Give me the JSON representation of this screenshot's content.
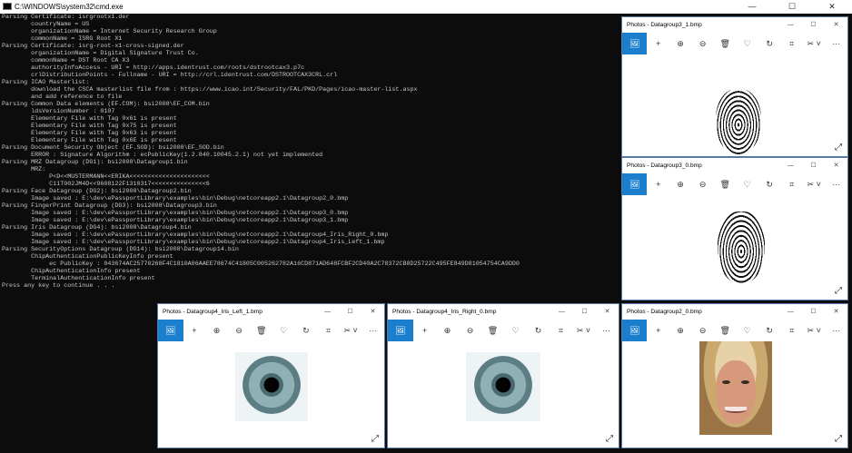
{
  "cmd": {
    "title": "C:\\WINDOWS\\system32\\cmd.exe",
    "controls": [
      "—",
      "☐",
      "✕"
    ],
    "lines": [
      "Parsing Certificate: isrgrootx1.der",
      "        countryName = US",
      "        organizationName = Internet Security Research Group",
      "        commonName = ISRG Root X1",
      "Parsing Certificate: isrg-root-x1-cross-signed.der",
      "        organizationName = Digital Signature Trust Co.",
      "        commonName = DST Root CA X3",
      "        authorityInfoAccess - URI = http://apps.identrust.com/roots/dstrootcax3.p7c",
      "        crlDistributionPoints - Fullname - URI = http://crl.identrust.com/DSTROOTCAX3CRL.crl",
      "Parsing ICAO Masterlist:",
      "        download the CSCA masterlist file from : https://www.icao.int/Security/FAL/PKD/Pages/icao-master-list.aspx",
      "        and add reference to file",
      "Parsing Common Data elements (EF.COM): bsi2008\\EF_COM.bin",
      "        ldsVersionNumber : 0107",
      "        Elementary File with Tag 0x61 is present",
      "        Elementary File with Tag 0x75 is present",
      "        Elementary File with Tag 0x63 is present",
      "        Elementary File with Tag 0x6E is present",
      "Parsing Document Security Object (EF.SOD): bsi2008\\EF_SOD.bin",
      "        ERROR : Signature Algorithm : ecPublicKey(1.2.840.10045.2.1) not yet implemented",
      "Parsing MRZ Datagroup (DG1): bsi2008\\Datagroup1.bin",
      "        MRZ:",
      "             P<D<<MUSTERMANN<<ERIKA<<<<<<<<<<<<<<<<<<<<<<",
      "             C11T002JM4D<<9608122F1310317<<<<<<<<<<<<<<<6",
      "Parsing Face Datagroup (DG2): bsi2008\\Datagroup2.bin",
      "        Image saved : E:\\dev\\ePassportLibrary\\examples\\bin\\Debug\\netcoreapp2.1\\Datagroup2_0.bmp",
      "Parsing FingerPrint Datagroup (DG3): bsi2008\\Datagroup3.bin",
      "        Image saved : E:\\dev\\ePassportLibrary\\examples\\bin\\Debug\\netcoreapp2.1\\Datagroup3_0.bmp",
      "        Image saved : E:\\dev\\ePassportLibrary\\examples\\bin\\Debug\\netcoreapp2.1\\Datagroup3_1.bmp",
      "Parsing Iris Datagroup (DG4): bsi2008\\Datagroup4.bin",
      "        Image saved : E:\\dev\\ePassportLibrary\\examples\\bin\\Debug\\netcoreapp2.1\\Datagroup4_Iris_Right_0.bmp",
      "        Image saved : E:\\dev\\ePassportLibrary\\examples\\bin\\Debug\\netcoreapp2.1\\Datagroup4_Iris_Left_1.bmp",
      "Parsing SecurityOptions Datagroup (DG14): bsi2008\\Datagroup14.bin",
      "        ChipAuthenticationPublicKeyInfo present",
      "             ec PublicKey : 043674AC25770268F4C1810A06AAEE78674C41805C005262782A16CD871AD648FCBF2CD40A2C78372CB8D25722C495FE849D81054754CA9DD0",
      "        ChipAuthenticationInfo present",
      "        TerminalAuthenticationInfo present",
      "Press any key to continue . . ."
    ]
  },
  "photos_toolbar": [
    "🖼",
    "+",
    "⊕",
    "⊖",
    "🗑",
    "♡",
    "↻",
    "⌗",
    "✂ ˅",
    "···"
  ],
  "photos_controls": [
    "—",
    "☐",
    "✕"
  ],
  "expand_icon": "⤢",
  "windows": [
    {
      "title": "Photos - Datagroup3_1.bmp",
      "image": "fingerprint"
    },
    {
      "title": "Photos - Datagroup3_0.bmp",
      "image": "fingerprint"
    },
    {
      "title": "Photos - Datagroup4_Iris_Left_1.bmp",
      "image": "iris"
    },
    {
      "title": "Photos - Datagroup4_Iris_Right_0.bmp",
      "image": "iris"
    },
    {
      "title": "Photos - Datagroup2_0.bmp",
      "image": "face"
    }
  ]
}
